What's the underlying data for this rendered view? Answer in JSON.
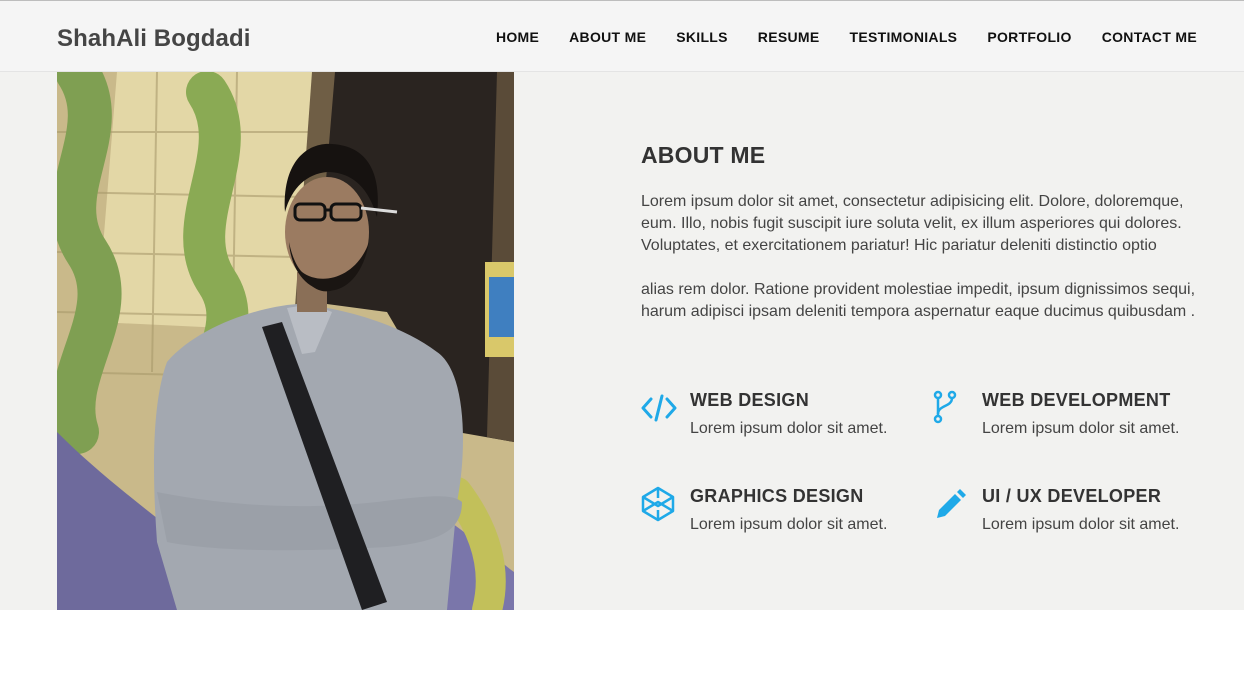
{
  "header": {
    "brand": "ShahAli Bogdadi",
    "nav": [
      "HOME",
      "ABOUT ME",
      "SKILLS",
      "RESUME",
      "TESTIMONIALS",
      "PORTFOLIO",
      "CONTACT ME"
    ]
  },
  "about": {
    "title": "ABOUT ME",
    "paragraph1": "Lorem ipsum dolor sit amet, consectetur adipisicing elit. Dolore, doloremque, eum. Illo, nobis fugit suscipit iure soluta velit, ex illum asperiores qui dolores. Voluptates, et exercitationem pariatur! Hic pariatur deleniti distinctio optio",
    "paragraph2": "alias rem dolor. Ratione provident molestiae impedit, ipsum dignissimos sequi, harum adipisci ipsam deleniti tempora aspernatur eaque ducimus quibusdam .",
    "services": [
      {
        "icon": "code-icon",
        "title": "WEB DESIGN",
        "text": "Lorem ipsum dolor sit amet."
      },
      {
        "icon": "git-fork-icon",
        "title": "WEB DEVELOPMENT",
        "text": "Lorem ipsum dolor sit amet."
      },
      {
        "icon": "codepen-cube-icon",
        "title": "GRAPHICS DESIGN",
        "text": "Lorem ipsum dolor sit amet."
      },
      {
        "icon": "pencil-icon",
        "title": "UI / UX DEVELOPER",
        "text": "Lorem ipsum dolor sit amet."
      }
    ]
  },
  "colors": {
    "accent": "#1fa9e8",
    "navbar_bg": "#f5f5f5",
    "section_bg": "#f2f2f0",
    "text_dark": "#333333"
  }
}
